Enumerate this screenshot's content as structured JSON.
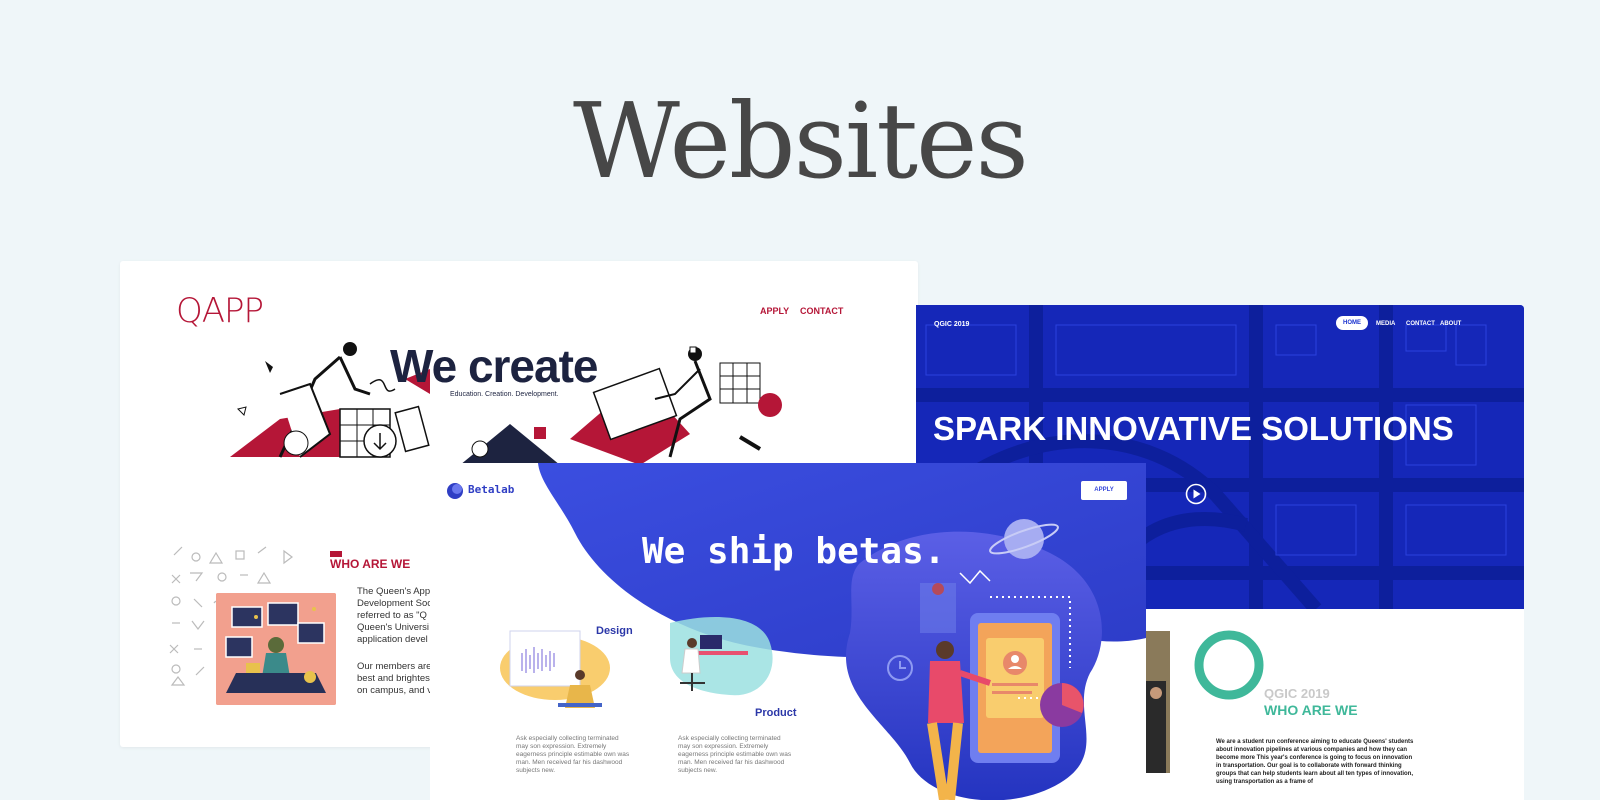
{
  "page": {
    "title": "Websites"
  },
  "qapp": {
    "logo": "QAPP",
    "nav": [
      "APPLY",
      "CONTACT"
    ],
    "hero_title": "We create",
    "hero_subtitle": "Education. Creation. Development.",
    "who_title": "WHO ARE WE",
    "paragraph_lines": [
      "The Queen's Appl",
      "Development Soc",
      "referred to as \"Q",
      "Queen's Universi",
      "application devel"
    ],
    "paragraph2_lines": [
      "Our members are",
      "best and brightes",
      "on campus, and v"
    ]
  },
  "qgic": {
    "logo": "QGIC 2019",
    "nav": [
      "HOME",
      "MEDIA",
      "CONTACT",
      "ABOUT"
    ],
    "hero_title": "SPARK INNOVATIVE SOLUTIONS",
    "year": "QGIC 2019",
    "who_title": "WHO ARE WE",
    "paragraph": "We are a student run conference aiming to educate Queens' students about innovation pipelines at various companies and how they can become more This year's conference is going to focus on innovation in transportation. Our goal is to collaborate with forward thinking groups that can help students learn about all ten types of innovation, using transportation as a frame of"
  },
  "betalab": {
    "logo": "Betalab",
    "apply": "APPLY",
    "hero_title": "We ship betas.",
    "design_label": "Design",
    "product_label": "Product",
    "design_text": "Ask especially collecting terminated may son expression. Extremely eagerness principle estimable own was man. Men received far his dashwood subjects new.",
    "product_text": "Ask especially collecting terminated may son expression. Extremely eagerness principle estimable own was man. Men received far his dashwood subjects new."
  },
  "colors": {
    "background": "#eff6f9",
    "qapp_red": "#b51637",
    "qgic_blue": "#1a32cf",
    "qgic_green": "#3fb89a",
    "betalab_blue": "#3446d9"
  }
}
